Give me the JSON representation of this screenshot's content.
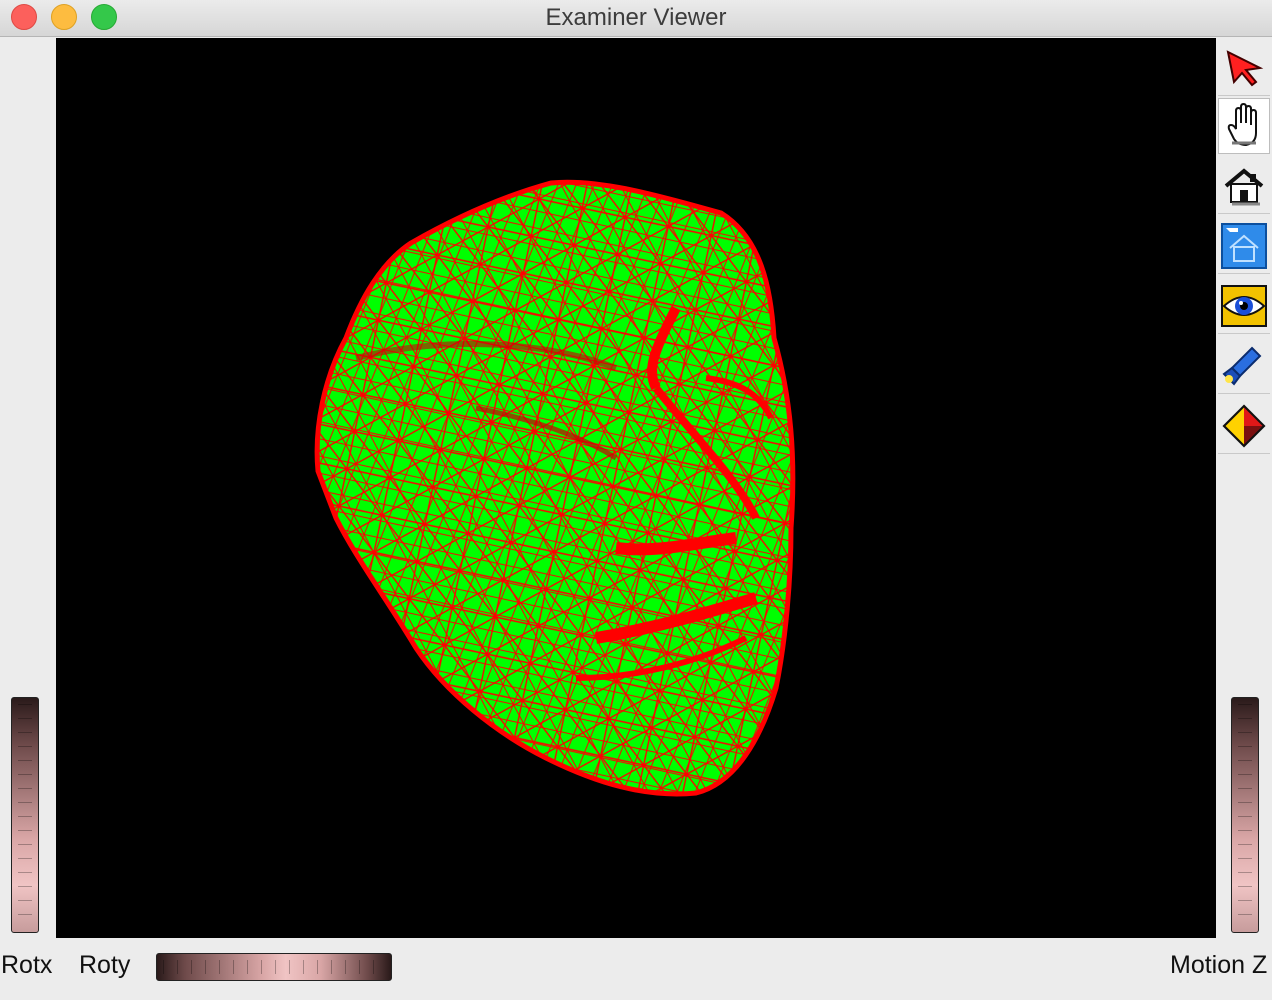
{
  "window": {
    "title": "Examiner Viewer"
  },
  "labels": {
    "rotx": "Rotx",
    "roty": "Roty",
    "motion_z": "Motion Z"
  },
  "tools": [
    {
      "id": "select",
      "icon": "arrow-pointer-icon",
      "active": false
    },
    {
      "id": "pan",
      "icon": "hand-icon",
      "active": true
    },
    {
      "id": "home",
      "icon": "home-icon",
      "active": false
    },
    {
      "id": "set-home",
      "icon": "set-home-icon",
      "active": false
    },
    {
      "id": "view-all",
      "icon": "eye-icon",
      "active": false
    },
    {
      "id": "seek",
      "icon": "flashlight-icon",
      "active": false
    },
    {
      "id": "projection",
      "icon": "cube-projection-icon",
      "active": false
    }
  ],
  "colors": {
    "mesh_fill": "#00ff00",
    "mesh_wire": "#ff0000",
    "background": "#000000"
  }
}
